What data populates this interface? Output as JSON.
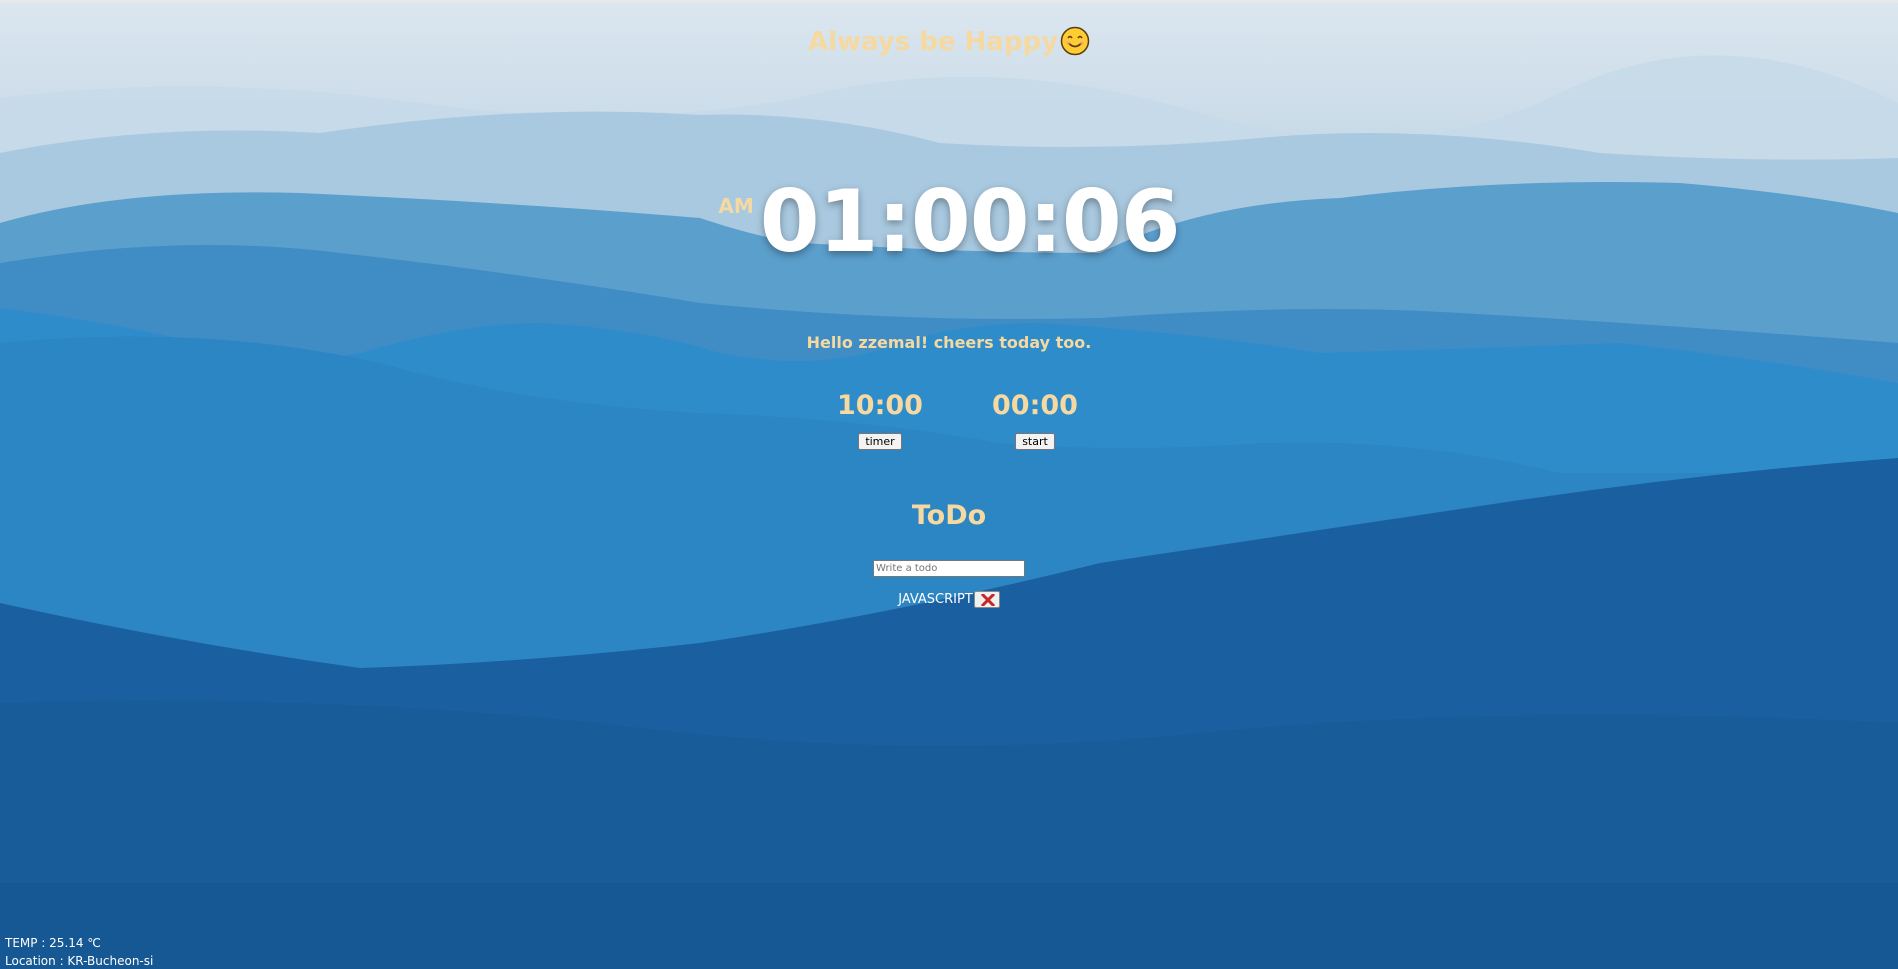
{
  "header": {
    "title": "Always be Happy",
    "icon": "smiling-face-icon"
  },
  "clock": {
    "ampm": "AM",
    "time": "01:00:06"
  },
  "greeting": "Hello zzemal! cheers today too.",
  "timers": [
    {
      "value": "10:00",
      "button_label": "timer"
    },
    {
      "value": "00:00",
      "button_label": "start"
    }
  ],
  "todo": {
    "title": "ToDo",
    "placeholder": "Write a todo",
    "items": [
      {
        "text": "JAVASCRIPT",
        "delete_icon": "close-x-icon"
      }
    ]
  },
  "weather": {
    "temp_line": "TEMP : 25.14 ℃",
    "location_line": "Location : KR-Bucheon-si"
  },
  "colors": {
    "accent": "#f5d9a0",
    "delete_x": "#c62828"
  }
}
